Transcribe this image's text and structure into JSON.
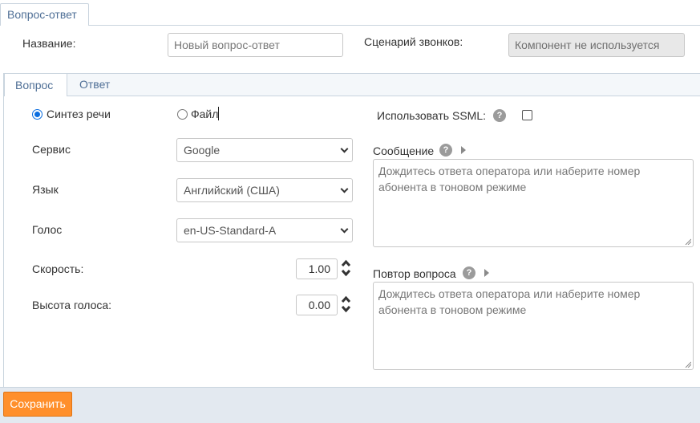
{
  "main_tab": {
    "label": "Вопрос-ответ"
  },
  "form": {
    "name_label": "Название:",
    "name_placeholder": "Новый вопрос-ответ",
    "scenario_label": "Сценарий звонков:",
    "scenario_value": "Компонент не используется"
  },
  "tabs": [
    {
      "label": "Вопрос",
      "active": true
    },
    {
      "label": "Ответ",
      "active": false
    }
  ],
  "source": {
    "options": [
      {
        "label": "Синтез речи",
        "checked": true
      },
      {
        "label": "Файл",
        "checked": false
      }
    ]
  },
  "settings": {
    "service": {
      "label": "Сервис",
      "value": "Google"
    },
    "language": {
      "label": "Язык",
      "value": "Английский (США)"
    },
    "voice": {
      "label": "Голос",
      "value": "en-US-Standard-A"
    },
    "speed": {
      "label": "Скорость:",
      "value": "1.00"
    },
    "pitch": {
      "label": "Высота голоса:",
      "value": "0.00"
    }
  },
  "right_panel": {
    "ssml_label": "Использовать SSML:",
    "ssml_checked": false,
    "message_label": "Сообщение",
    "message_placeholder": "Дождитесь ответа оператора или наберите номер абонента в тоновом режиме",
    "repeat_label": "Повтор вопроса",
    "repeat_placeholder": "Дождитесь ответа оператора или наберите номер абонента в тоновом режиме"
  },
  "icons": {
    "help": "?",
    "expand": "triangle-right-icon",
    "dropdown": "chevron-down-icon",
    "stepper": "up-down-arrows-icon",
    "resize": "resize-grip-icon"
  },
  "footer": {
    "save_label": "Сохранить"
  },
  "colors": {
    "accent_tab_text": "#4f6f96",
    "save_button": "#ff8f2b",
    "radio_checked": "#0b6ee0"
  }
}
